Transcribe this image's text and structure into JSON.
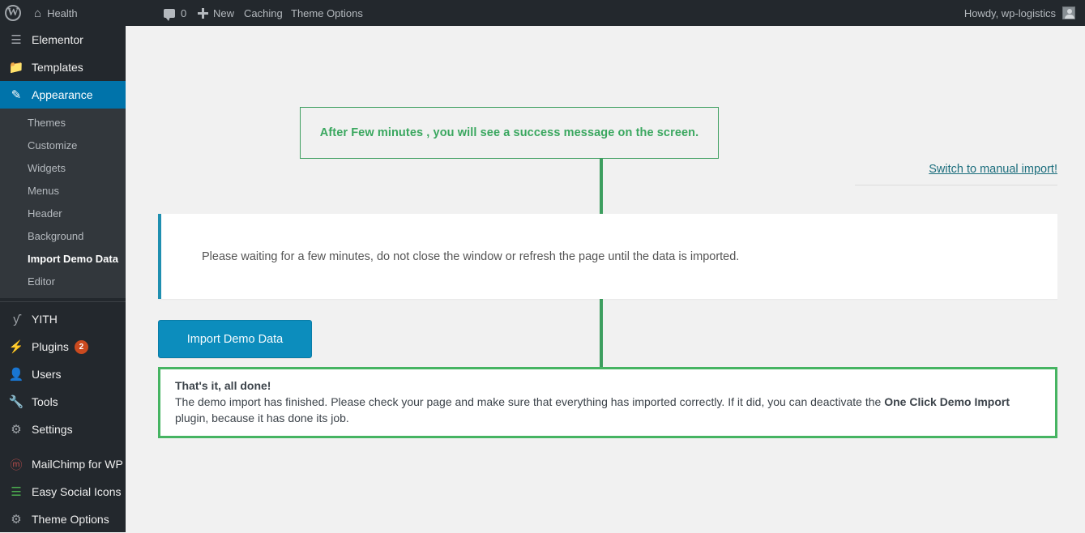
{
  "adminbar": {
    "wp_logo": "W",
    "site_name": "Health",
    "home_icon": "⌂",
    "comments_count": "0",
    "new_label": "New",
    "caching_label": "Caching",
    "theme_options_label": "Theme Options",
    "howdy": "Howdy, wp-logistics"
  },
  "sidebar": {
    "items": [
      {
        "label": "Elementor",
        "icon": "☰",
        "current": false
      },
      {
        "label": "Templates",
        "icon": "📁",
        "current": false
      },
      {
        "label": "Appearance",
        "icon": "✎",
        "current": true
      },
      {
        "label": "YITH",
        "icon": "ƴ",
        "current": false
      },
      {
        "label": "Plugins",
        "icon": "⚡",
        "current": false,
        "badge": "2"
      },
      {
        "label": "Users",
        "icon": "👤",
        "current": false
      },
      {
        "label": "Tools",
        "icon": "🔧",
        "current": false
      },
      {
        "label": "Settings",
        "icon": "⚙",
        "current": false
      },
      {
        "label": "MailChimp for WP",
        "icon": "ⓜ",
        "current": false
      },
      {
        "label": "Easy Social Icons",
        "icon": "☰",
        "current": false
      },
      {
        "label": "Theme Options",
        "icon": "⚙",
        "current": false
      }
    ],
    "appearance_submenu": [
      {
        "label": "Themes",
        "active": false
      },
      {
        "label": "Customize",
        "active": false
      },
      {
        "label": "Widgets",
        "active": false
      },
      {
        "label": "Menus",
        "active": false
      },
      {
        "label": "Header",
        "active": false
      },
      {
        "label": "Background",
        "active": false
      },
      {
        "label": "Import Demo Data",
        "active": true
      },
      {
        "label": "Editor",
        "active": false
      }
    ]
  },
  "main": {
    "announcement": "After Few minutes , you will see a success message on the screen.",
    "switch_link": "Switch to manual import!",
    "waiting_message": "Please waiting for a few minutes, do not close the window or refresh the page until the data is imported.",
    "import_button": "Import Demo Data",
    "success": {
      "title": "That's it, all done!",
      "body_part1": "The demo import has finished. Please check your page and make sure that everything has imported correctly. If it did, you can deactivate the ",
      "plugin_name": "One Click Demo Import",
      "body_part2": " plugin, because it has done its job."
    }
  },
  "colors": {
    "admin_dark": "#23282d",
    "submenu_dark": "#32373c",
    "accent_blue": "#0073aa",
    "button_blue": "#0c8dbd",
    "success_green": "#46b462",
    "announce_green": "#3aa75f",
    "panel_teal": "#1f8fb0",
    "badge_orange": "#ca4a1f",
    "link_teal": "#1c6e7d"
  }
}
